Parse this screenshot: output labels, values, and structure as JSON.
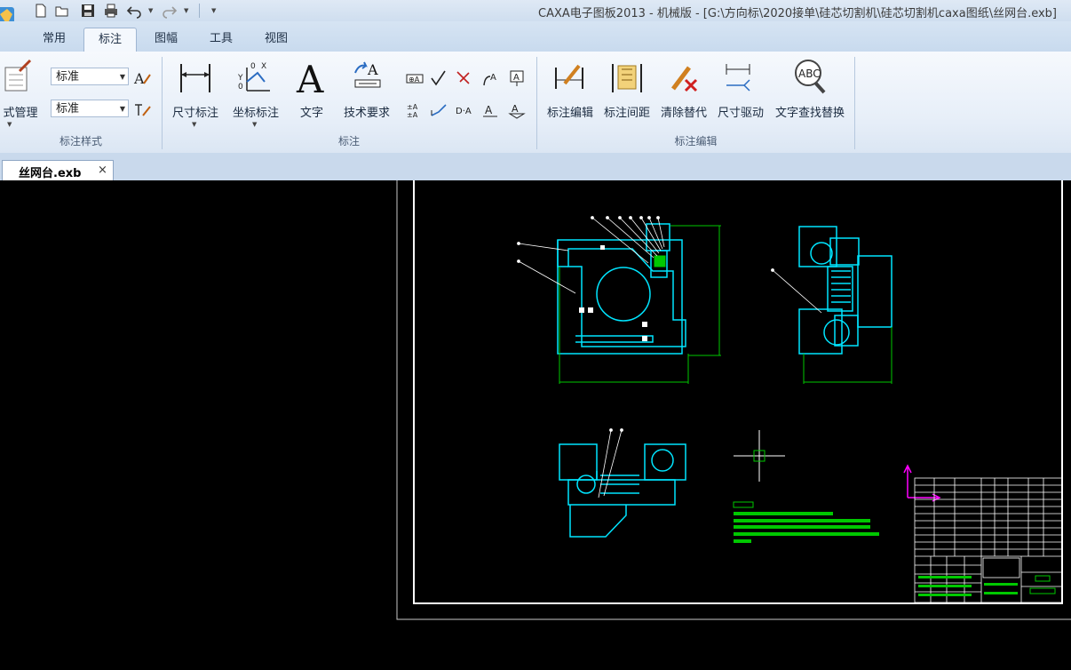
{
  "window": {
    "title": "CAXA电子图板2013 - 机械版 - [G:\\方向标\\2020接单\\硅芯切割机\\硅芯切割机caxa图纸\\丝网台.exb]"
  },
  "quick_access": [
    "new-icon",
    "open-icon",
    "save-icon",
    "print-icon",
    "undo-icon",
    "redo-icon",
    "customize-icon"
  ],
  "tabs": [
    {
      "label": "常用",
      "active": false
    },
    {
      "label": "标注",
      "active": true
    },
    {
      "label": "图幅",
      "active": false
    },
    {
      "label": "工具",
      "active": false
    },
    {
      "label": "视图",
      "active": false
    }
  ],
  "ribbon": {
    "style_group": {
      "label": "标注样式",
      "manage_label": "式管理",
      "combo1": "标准",
      "combo2": "标准"
    },
    "annot_group": {
      "label": "标注",
      "buttons": [
        "尺寸标注",
        "坐标标注",
        "文字",
        "技术要求"
      ]
    },
    "edit_group": {
      "label": "标注编辑",
      "buttons": [
        "标注编辑",
        "标注间距",
        "清除替代",
        "尺寸驱动",
        "文字查找替换"
      ]
    }
  },
  "document_tab": {
    "name": "丝网台.exb",
    "close": "×"
  },
  "colors": {
    "canvas": "#000000",
    "drawing": "#00e5ff",
    "dims": "#00c800",
    "frame": "#ffffff",
    "axis": "#ff00ff"
  }
}
